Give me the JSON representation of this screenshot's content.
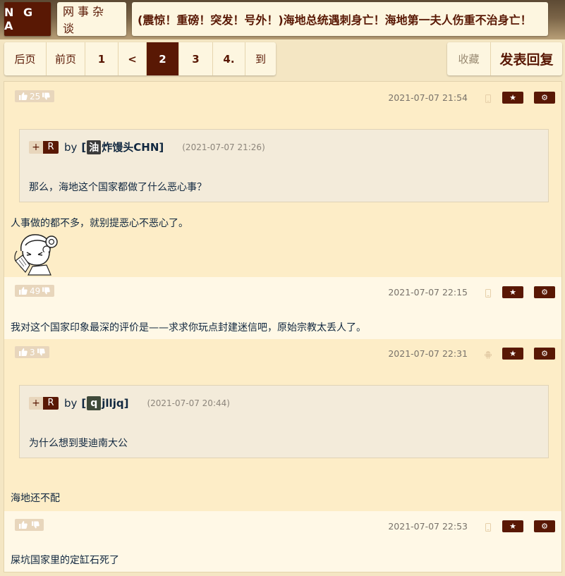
{
  "header": {
    "logo": "N G A",
    "board": "网事杂谈",
    "title": "(震惊！重磅！突发！号外！)海地总统遇刺身亡！海地第一夫人伤重不治身亡！"
  },
  "pager": {
    "items": [
      "后页",
      "前页",
      "1",
      "<",
      "2",
      "3",
      "4.",
      "到"
    ],
    "active_index": 4
  },
  "actions": {
    "favorite": "收藏",
    "reply": "发表回复"
  },
  "colors": {
    "brand": "#591804",
    "post_dark": "#fdedc7",
    "post_light": "#fff8e6",
    "quote_bg": "#f3ebda"
  },
  "posts": [
    {
      "likes": "25",
      "date": "2021-07-07 21:54",
      "device": "phone-icon",
      "quote": {
        "plus": "+",
        "tag": "R",
        "by": "by",
        "name_prefix": "[",
        "name_avatar": "油",
        "name_rest": "炸馒头CHN]",
        "time": "(2021-07-07 21:26)",
        "text": "那么，海地这个国家都做了什么恶心事？"
      },
      "text": "人事做的都不多，就别提恶心不恶心了。",
      "sticker": "anime-girl-sticker"
    },
    {
      "likes": "49",
      "date": "2021-07-07 22:15",
      "device": "phone-icon",
      "text": "我对这个国家印象最深的评价是——求求你玩点封建迷信吧，原始宗教太丢人了。"
    },
    {
      "likes": "3",
      "date": "2021-07-07 22:31",
      "device": "android-icon",
      "quote": {
        "plus": "+",
        "tag": "R",
        "by": "by",
        "name_prefix": "[",
        "name_avatar": "q",
        "name_rest": "jlljq]",
        "time": "(2021-07-07 20:44)",
        "text": "为什么想到斐迪南大公"
      },
      "text": "海地还不配"
    },
    {
      "likes": "",
      "date": "2021-07-07 22:53",
      "device": "phone-icon",
      "text": "屎坑国家里的定缸石死了"
    }
  ]
}
